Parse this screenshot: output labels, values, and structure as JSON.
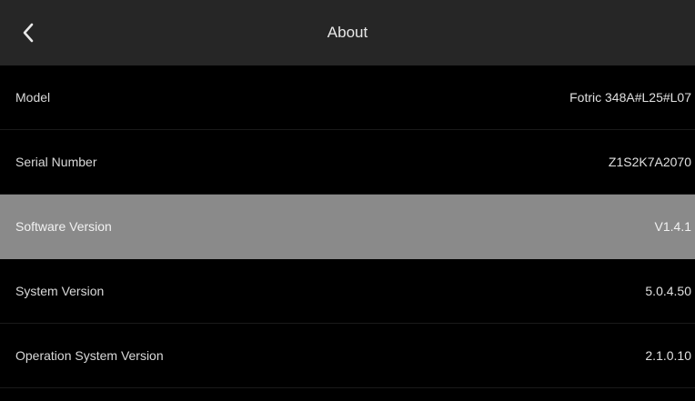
{
  "header": {
    "title": "About",
    "back_icon": "chevron-left-icon"
  },
  "colors": {
    "header_bg": "#262626",
    "page_bg": "#000000",
    "selected_row_bg": "#8a8a8a"
  },
  "rows": [
    {
      "label": "Model",
      "value": "Fotric 348A#L25#L07",
      "selected": false
    },
    {
      "label": "Serial Number",
      "value": "Z1S2K7A2070",
      "selected": false
    },
    {
      "label": "Software Version",
      "value": "V1.4.1",
      "selected": true
    },
    {
      "label": "System Version",
      "value": "5.0.4.50",
      "selected": false
    },
    {
      "label": "Operation System Version",
      "value": "2.1.0.10",
      "selected": false
    }
  ]
}
